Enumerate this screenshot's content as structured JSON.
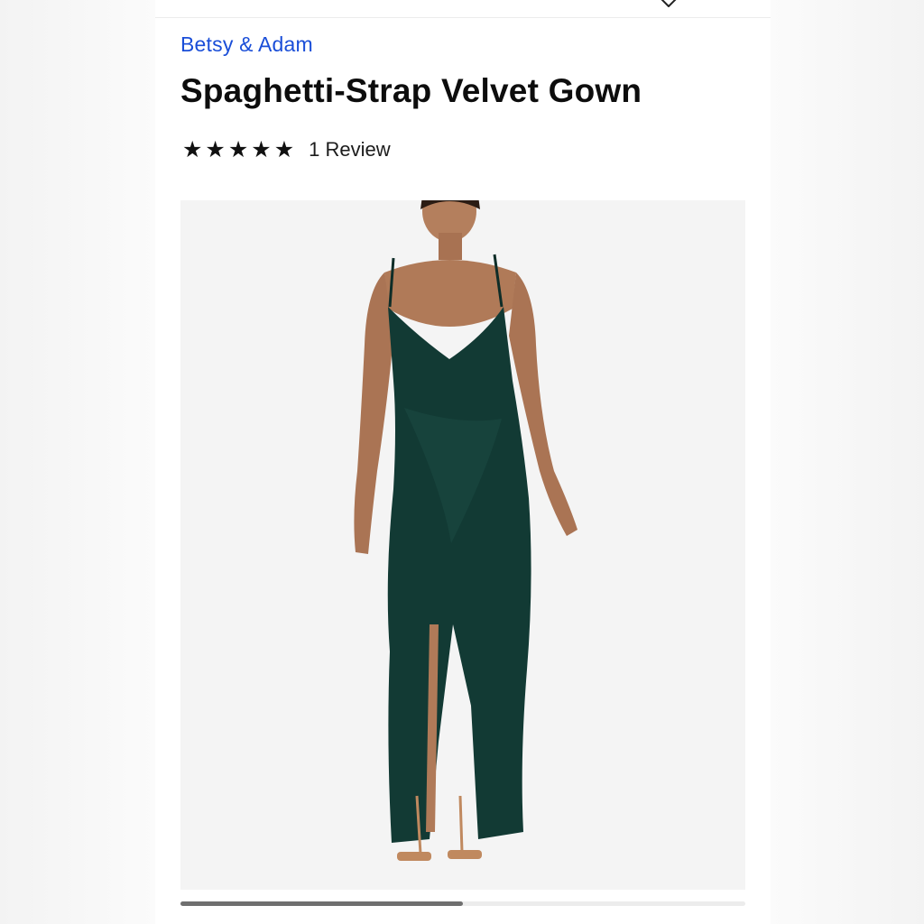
{
  "product": {
    "brand": "Betsy & Adam",
    "title": "Spaghetti-Strap Velvet Gown",
    "rating": {
      "stars": 5,
      "review_label": "1 Review"
    },
    "image_alt": "Model wearing a dark green velvet gown",
    "gallery_progress": 0.5
  },
  "icons": {
    "star": "★",
    "wishlist": "heart-icon",
    "menu": "menu-icon"
  },
  "colors": {
    "brand_link": "#1a4ed8",
    "gown": "#123a34"
  }
}
